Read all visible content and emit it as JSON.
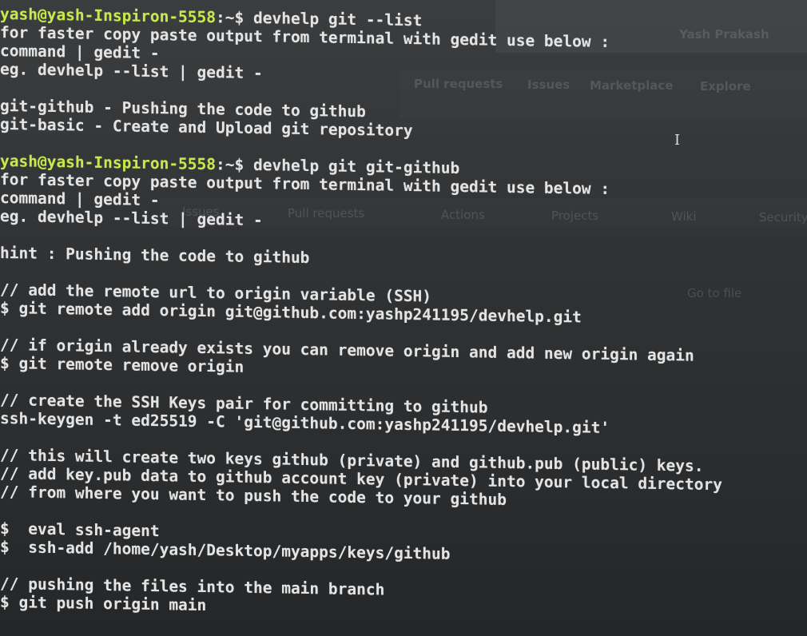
{
  "background_ui": {
    "user_name": "Yash Prakash",
    "nav_links": [
      "Pull requests",
      "Issues",
      "Marketplace",
      "Explore"
    ],
    "repo_tabs": [
      "Issues",
      "Pull requests",
      "Actions",
      "Projects",
      "Wiki",
      "Security"
    ],
    "go_to_file": "Go to file"
  },
  "terminal": {
    "blocks": [
      {
        "prompt": "yash@yash-Inspiron-5558",
        "path": ":~$ ",
        "command": "devhelp git --list",
        "output": [
          "for faster copy paste output from terminal with gedit use below :",
          "command | gedit -",
          "eg. devhelp --list | gedit -",
          "",
          "git-github - Pushing the code to github",
          "git-basic - Create and Upload git repository",
          ""
        ]
      },
      {
        "prompt": "yash@yash-Inspiron-5558",
        "path": ":~$ ",
        "command": "devhelp git git-github",
        "output": [
          "for faster copy paste output from terminal with gedit use below :",
          "command | gedit -",
          "eg. devhelp --list | gedit -",
          "",
          "hint : Pushing the code to github",
          "",
          "// add the remote url to origin variable (SSH)",
          "$ git remote add origin git@github.com:yashp241195/devhelp.git",
          "",
          "// if origin already exists you can remove origin and add new origin again",
          "$ git remote remove origin",
          "",
          "// create the SSH Keys pair for committing to github",
          "ssh-keygen -t ed25519 -C 'git@github.com:yashp241195/devhelp.git'",
          "",
          "// this will create two keys github (private) and github.pub (public) keys.",
          "// add key.pub data to github account key (private) into your local directory",
          "// from where you want to push the code to your github",
          "",
          "$  eval ssh-agent",
          "$  ssh-add /home/yash/Desktop/myapps/keys/github",
          "",
          "// pushing the files into the main branch",
          "$ git push origin main"
        ]
      }
    ]
  }
}
